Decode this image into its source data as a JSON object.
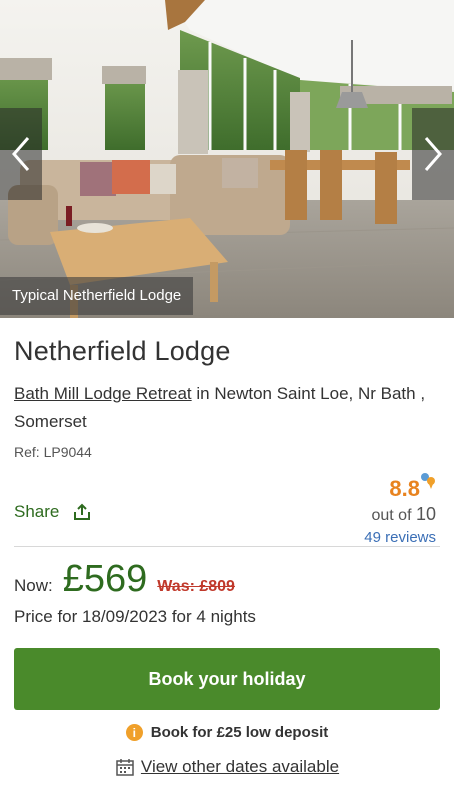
{
  "gallery": {
    "caption": "Typical Netherfield Lodge",
    "prev_icon": "chevron-left-icon",
    "next_icon": "chevron-right-icon"
  },
  "property": {
    "title": "Netherfield Lodge",
    "park_link": "Bath Mill Lodge Retreat",
    "location_text": " in Newton Saint Loe, Nr Bath , Somerset",
    "ref": "Ref: LP9044"
  },
  "share": {
    "label": "Share",
    "icon": "share-icon"
  },
  "rating": {
    "score": "8.8",
    "out_of_prefix": "out of ",
    "out_of_value": "10",
    "reviews": "49 reviews"
  },
  "pricing": {
    "now_label": "Now:",
    "price": "£569",
    "was": "Was: £809",
    "price_for": "Price for 18/09/2023 for 4 nights"
  },
  "actions": {
    "book_label": "Book your holiday",
    "deposit_text": "Book for £25 low deposit",
    "other_dates": "View other dates available"
  },
  "colors": {
    "brand_green": "#4a8a2b",
    "price_green": "#2e6b1f",
    "rating_orange": "#e8831f",
    "was_red": "#c0392b",
    "link_blue": "#3b6fb6"
  }
}
